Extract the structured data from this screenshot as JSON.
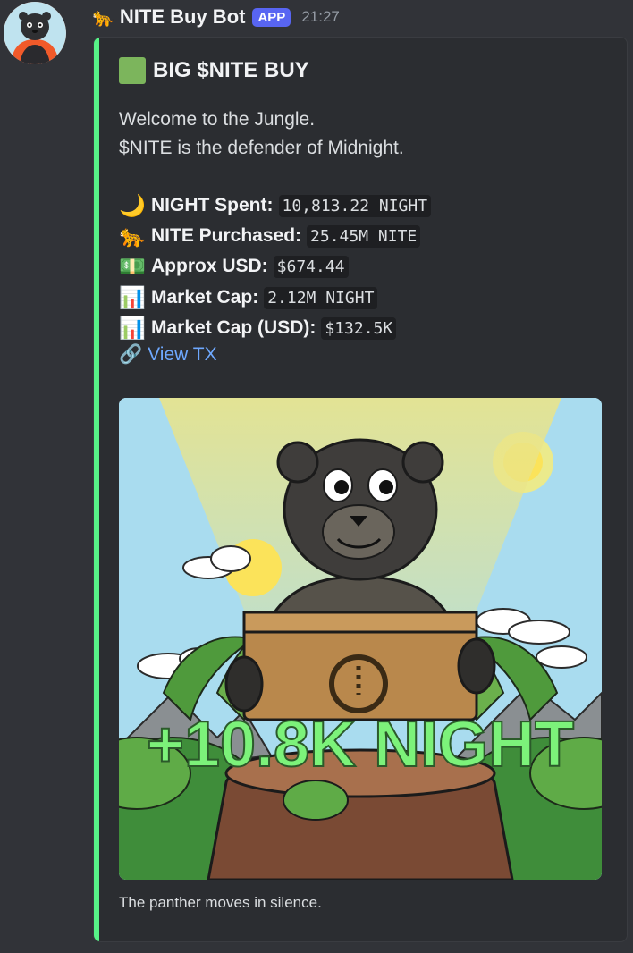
{
  "author": {
    "emoji": "🐆",
    "name": "NITE Buy Bot",
    "badge": "APP",
    "time": "21:27"
  },
  "embed": {
    "title": "BIG $NITE BUY",
    "description": [
      "Welcome to the Jungle.",
      "$NITE is the defender of Midnight."
    ],
    "stats": [
      {
        "emoji": "🌙",
        "label": "NIGHT Spent:",
        "value": "10,813.22 NIGHT"
      },
      {
        "emoji": "🐆",
        "label": "NITE Purchased:",
        "value": "25.45M NITE"
      },
      {
        "emoji": "💵",
        "label": "Approx USD:",
        "value": "$674.44"
      },
      {
        "emoji": "📊",
        "label": "Market Cap:",
        "value": "2.12M NIGHT"
      },
      {
        "emoji": "📊",
        "label": "Market Cap (USD):",
        "value": "$132.5K"
      }
    ],
    "link": {
      "emoji": "🔗",
      "label": "View TX"
    },
    "image_overlay_text": "+10.8K NIGHT",
    "footer": "The panther moves in silence."
  },
  "colors": {
    "embed_accent": "#57f287",
    "app_badge": "#5865f2",
    "link": "#6ea8fe",
    "overlay_text": "#7cf27a"
  }
}
